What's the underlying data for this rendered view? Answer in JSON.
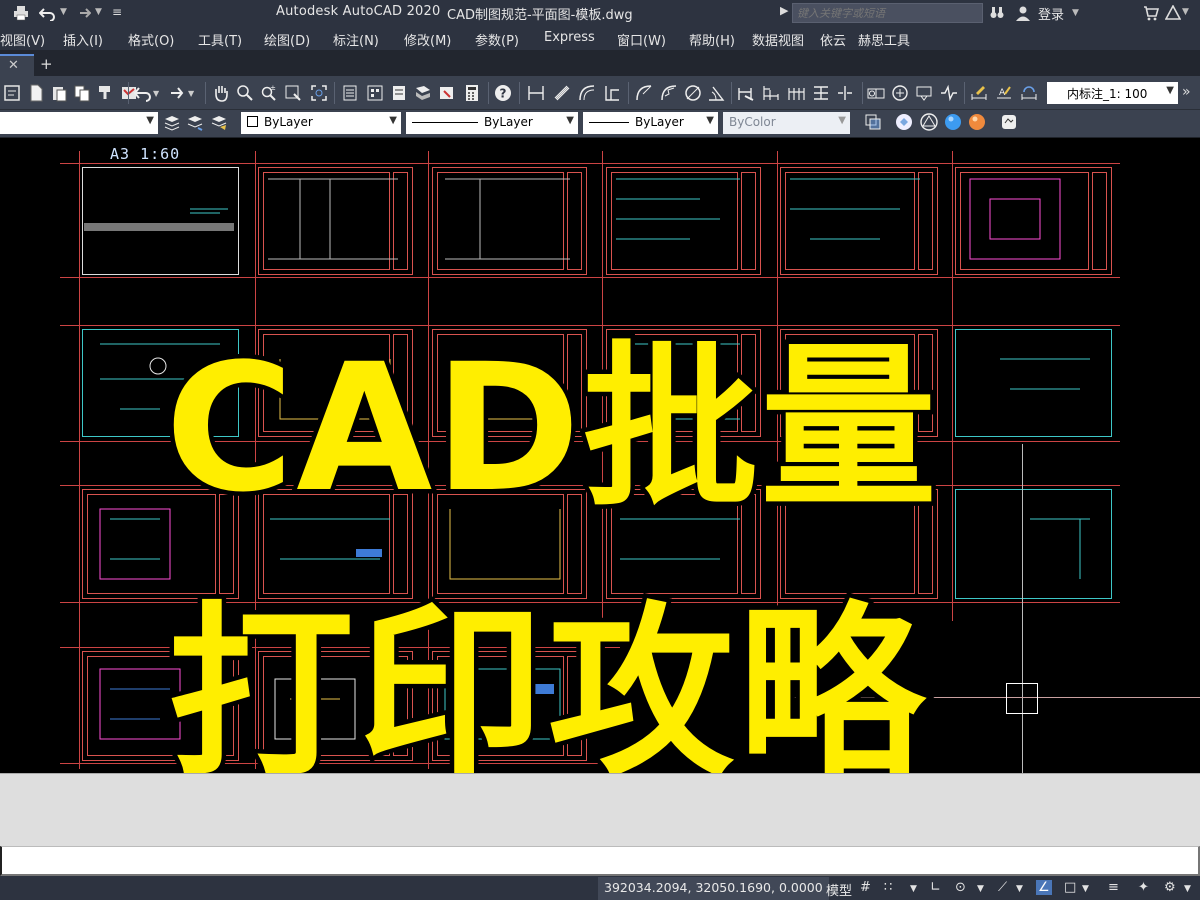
{
  "titlebar": {
    "app_title": "Autodesk AutoCAD 2020",
    "doc_title": "CAD制图规范-平面图-模板.dwg",
    "search_placeholder": "键入关键字或短语",
    "login_label": "登录"
  },
  "menu": {
    "items": [
      "视图(V)",
      "插入(I)",
      "格式(O)",
      "工具(T)",
      "绘图(D)",
      "标注(N)",
      "修改(M)",
      "参数(P)",
      "Express",
      "窗口(W)",
      "帮助(H)",
      "数据视图",
      "依云",
      "赫思工具"
    ]
  },
  "toolbar": {
    "dim_scale": "内标注_1: 100",
    "layer_color": "ByLayer",
    "linetype": "ByLayer",
    "lineweight": "ByLayer",
    "plot_style": "ByColor"
  },
  "drawing": {
    "scale_label": "A3    1:60",
    "overlay_line1": "CAD批量",
    "overlay_line2": "打印攻略"
  },
  "statusbar": {
    "coordinates": "392034.2094, 32050.1690, 0.0000",
    "model_label": "模型"
  }
}
